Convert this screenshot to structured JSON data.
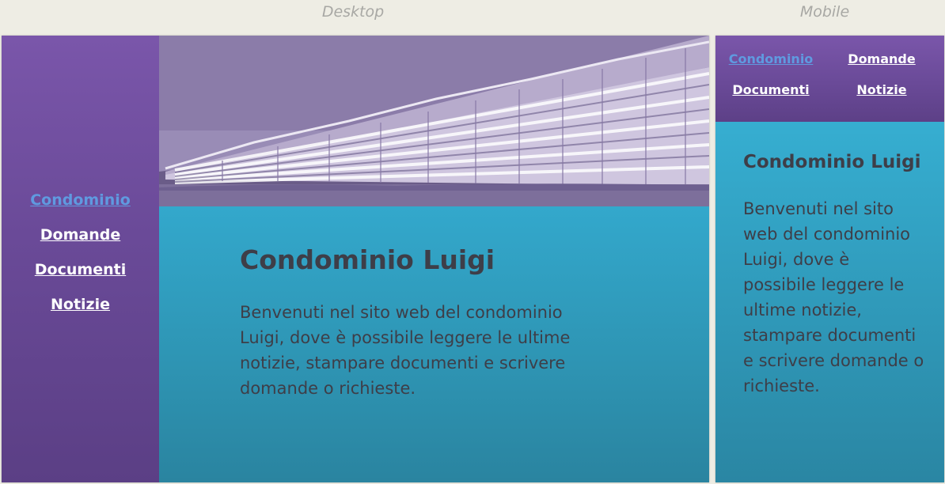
{
  "labels": {
    "desktop": "Desktop",
    "mobile": "Mobile"
  },
  "nav": {
    "items": [
      {
        "label": "Condominio",
        "active": true
      },
      {
        "label": "Domande",
        "active": false
      },
      {
        "label": "Documenti",
        "active": false
      },
      {
        "label": "Notizie",
        "active": false
      }
    ]
  },
  "hero": {
    "image": "apartment-building-photo"
  },
  "content": {
    "title": "Condominio Luigi",
    "text": "Benvenuti nel sito web del condominio Luigi, dove è possibile leggere le ultime notizie, stampare documenti e scrivere domande o richieste."
  },
  "colors": {
    "page_bg": "#eeede4",
    "sidebar": "#6a4a98",
    "content": "#2e95b4",
    "active_link": "#5f9ae0",
    "link": "#ffffff",
    "text": "#3e3e48"
  }
}
